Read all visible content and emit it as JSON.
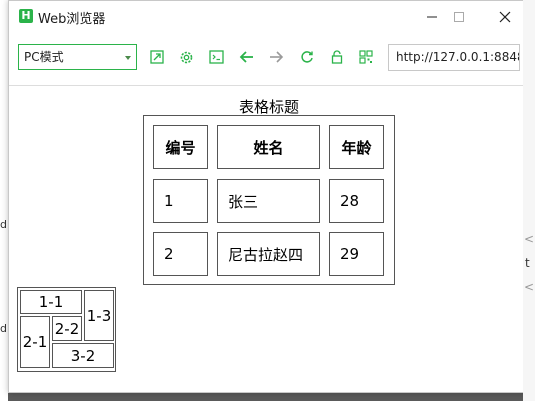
{
  "window": {
    "title": "Web浏览器",
    "app_icon_letter": "H",
    "controls": {
      "minimize": "—",
      "maximize": "☐",
      "close": "✕"
    }
  },
  "toolbar": {
    "mode": "PC模式",
    "url": "http://127.0.0.1:8848",
    "icons": [
      "open-external-icon",
      "settings-icon",
      "console-icon",
      "back-icon",
      "forward-icon",
      "refresh-icon",
      "lock-icon",
      "qr-code-icon"
    ],
    "accent_color": "#2bb34a"
  },
  "background_text": {
    "left": [
      "d",
      "d"
    ],
    "right": [
      "<",
      "t",
      "<"
    ]
  },
  "page": {
    "caption": "表格标题",
    "headers": [
      "编号",
      "姓名",
      "年龄"
    ],
    "rows": [
      [
        "1",
        "张三",
        "28"
      ],
      [
        "2",
        "尼古拉赵四",
        "29"
      ]
    ],
    "merged_table": {
      "c11": "1-1",
      "c13": "1-3",
      "c21": "2-1",
      "c22": "2-2",
      "c32": "3-2"
    }
  }
}
